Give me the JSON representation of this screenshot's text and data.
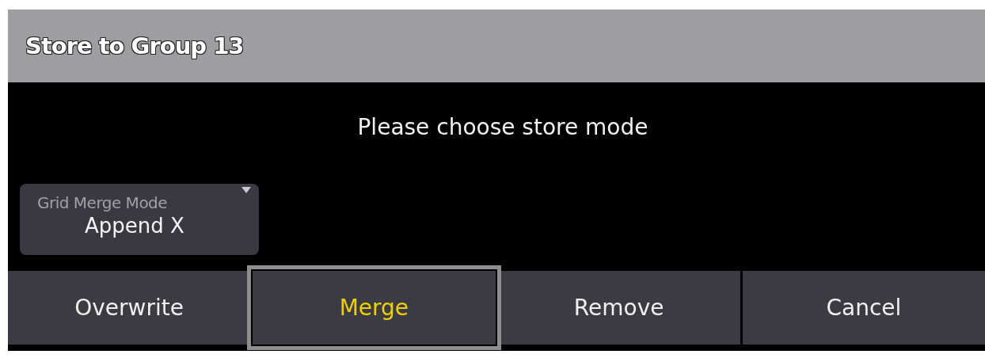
{
  "dialog": {
    "title": "Store to Group 13",
    "message": "Please choose store mode"
  },
  "dropdown": {
    "label": "Grid Merge Mode",
    "value": "Append X"
  },
  "buttons": [
    {
      "label": "Overwrite",
      "selected": false
    },
    {
      "label": "Merge",
      "selected": true
    },
    {
      "label": "Remove",
      "selected": false
    },
    {
      "label": "Cancel",
      "selected": false
    }
  ]
}
